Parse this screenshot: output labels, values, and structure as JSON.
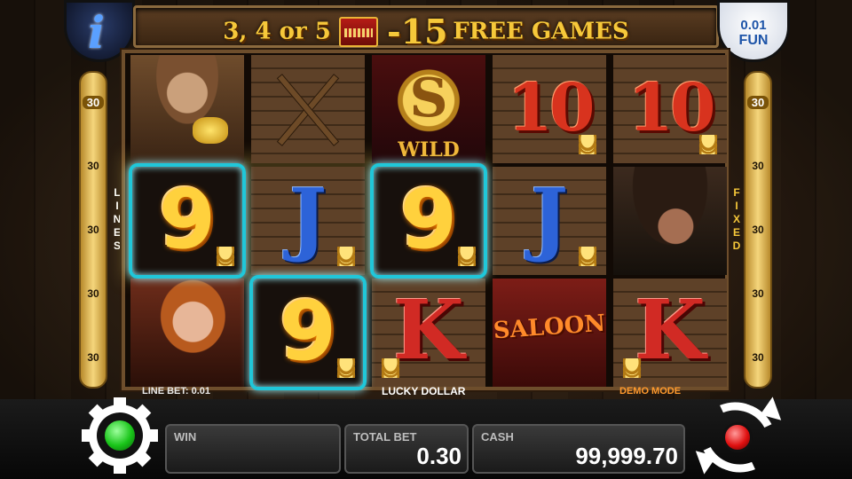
{
  "header": {
    "prefix": "3, 4 or 5",
    "amount": "-15",
    "suffix": "FREE GAMES",
    "scatter_icon": "saloon-scatter-icon"
  },
  "info_button": {
    "glyph": "i"
  },
  "fun_button": {
    "denomination": "0.01",
    "mode": "FUN"
  },
  "left_lines": {
    "label": "LINES",
    "values": [
      "30",
      "30",
      "30",
      "30",
      "30"
    ]
  },
  "right_lines": {
    "label": "FIXED",
    "values": [
      "30",
      "30",
      "30",
      "30",
      "30"
    ]
  },
  "reels": [
    [
      "prospector",
      "9",
      "woman"
    ],
    [
      "pickaxe-shovel",
      "J",
      "9"
    ],
    [
      "wild",
      "9",
      "K"
    ],
    [
      "10",
      "J",
      "saloon"
    ],
    [
      "10",
      "bandit",
      "K"
    ]
  ],
  "symbols": {
    "nine": "9",
    "jack": "J",
    "king": "K",
    "ten": "10",
    "wild_letter": "S",
    "wild_word": "WILD",
    "saloon_word": "SALOON"
  },
  "info_strip": {
    "line_bet": "LINE BET: 0.01",
    "game_name": "LUCKY DOLLAR",
    "mode": "DEMO MODE"
  },
  "meters": {
    "win_label": "WIN",
    "win_value": "",
    "total_bet_label": "TOTAL BET",
    "total_bet_value": "0.30",
    "cash_label": "CASH",
    "cash_value": "99,999.70"
  },
  "colors": {
    "win_frame": "#20c7d9",
    "gold_text": "#f6c83a",
    "autoplay_led": "#18c418",
    "spin_led": "#e01010"
  }
}
